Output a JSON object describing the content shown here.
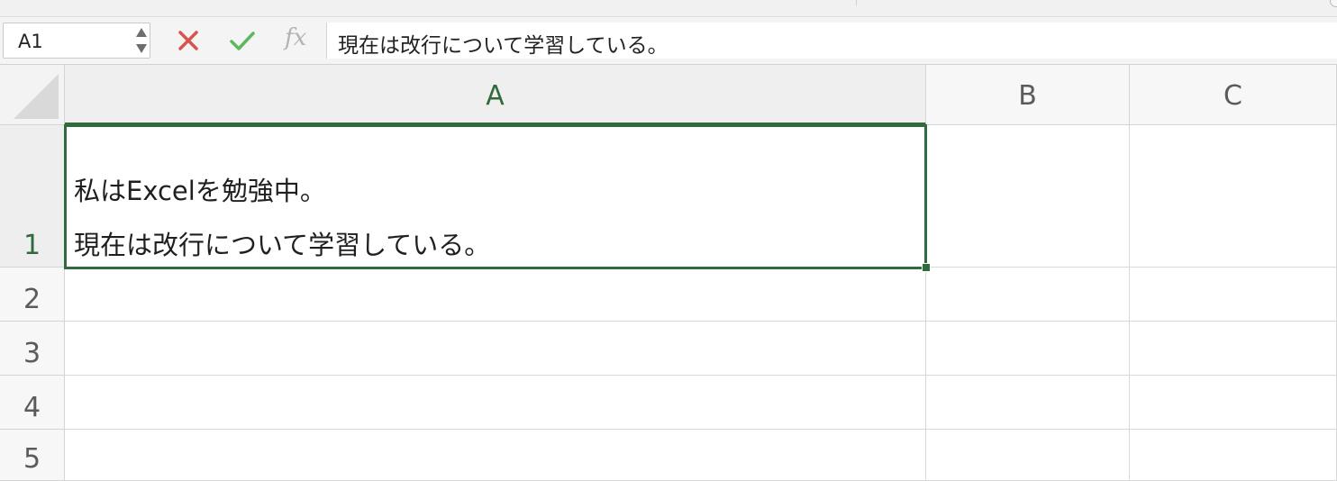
{
  "formula_bar": {
    "name_box": "A1",
    "fx": "fx",
    "formula": "現在は改行について学習している。"
  },
  "columns": [
    {
      "label": "A"
    },
    {
      "label": "B"
    },
    {
      "label": "C"
    }
  ],
  "rows": [
    {
      "label": "1"
    },
    {
      "label": "2"
    },
    {
      "label": "3"
    },
    {
      "label": "4"
    },
    {
      "label": "5"
    }
  ],
  "cells": {
    "A1": {
      "line1": "私はExcelを勉強中。",
      "line2": "現在は改行について学習している。"
    }
  },
  "colors": {
    "selection": "#2f6b3c",
    "cancel": "#d9534f",
    "enter": "#5cb85c"
  }
}
